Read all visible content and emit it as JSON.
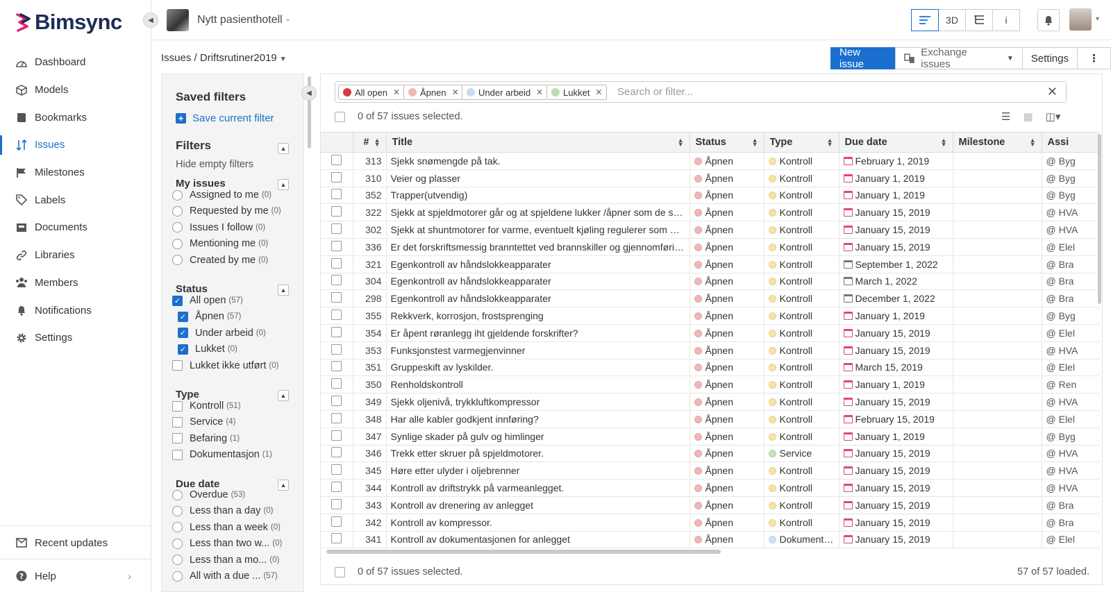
{
  "app": {
    "logo_text": "Bimsync",
    "project_name": "Nytt pasienthotell"
  },
  "nav": {
    "items": [
      {
        "label": "Dashboard",
        "icon": "dashboard-icon"
      },
      {
        "label": "Models",
        "icon": "cube-icon"
      },
      {
        "label": "Bookmarks",
        "icon": "book-icon"
      },
      {
        "label": "Issues",
        "icon": "issues-icon",
        "active": true
      },
      {
        "label": "Milestones",
        "icon": "flag-icon"
      },
      {
        "label": "Labels",
        "icon": "tag-icon"
      },
      {
        "label": "Documents",
        "icon": "inbox-icon"
      },
      {
        "label": "Libraries",
        "icon": "link-icon"
      },
      {
        "label": "Members",
        "icon": "users-icon"
      },
      {
        "label": "Notifications",
        "icon": "bell-icon"
      },
      {
        "label": "Settings",
        "icon": "gear-icon"
      }
    ],
    "recent_updates": "Recent updates",
    "help": "Help"
  },
  "topbar": {
    "view_buttons": [
      "",
      "3D",
      "",
      "i"
    ]
  },
  "breadcrumb": {
    "root": "Issues",
    "separator": "/",
    "current": "Driftsrutiner2019"
  },
  "actions": {
    "new_issue": "New issue",
    "exchange": "Exchange issues",
    "settings": "Settings"
  },
  "filters": {
    "saved_title": "Saved filters",
    "save_current": "Save current filter",
    "title": "Filters",
    "hide_empty": "Hide empty filters",
    "my_issues": {
      "title": "My issues",
      "options": [
        {
          "label": "Assigned to me",
          "count": "(0)"
        },
        {
          "label": "Requested by me",
          "count": "(0)"
        },
        {
          "label": "Issues I follow",
          "count": "(0)"
        },
        {
          "label": "Mentioning me",
          "count": "(0)"
        },
        {
          "label": "Created by me",
          "count": "(0)"
        }
      ]
    },
    "status": {
      "title": "Status",
      "options": [
        {
          "label": "All open",
          "count": "(57)",
          "checked": true,
          "indent": false
        },
        {
          "label": "Åpnen",
          "count": "(57)",
          "checked": true,
          "indent": true
        },
        {
          "label": "Under arbeid",
          "count": "(0)",
          "checked": true,
          "indent": true
        },
        {
          "label": "Lukket",
          "count": "(0)",
          "checked": true,
          "indent": true
        },
        {
          "label": "Lukket ikke utført",
          "count": "(0)",
          "checked": false,
          "indent": false
        }
      ]
    },
    "type": {
      "title": "Type",
      "options": [
        {
          "label": "Kontroll",
          "count": "(51)"
        },
        {
          "label": "Service",
          "count": "(4)"
        },
        {
          "label": "Befaring",
          "count": "(1)"
        },
        {
          "label": "Dokumentasjon",
          "count": "(1)"
        }
      ]
    },
    "due_date": {
      "title": "Due date",
      "options": [
        {
          "label": "Overdue",
          "count": "(53)"
        },
        {
          "label": "Less than a day",
          "count": "(0)"
        },
        {
          "label": "Less than a week",
          "count": "(0)"
        },
        {
          "label": "Less than two w...",
          "count": "(0)"
        },
        {
          "label": "Less than a mo...",
          "count": "(0)"
        },
        {
          "label": "All with a due ...",
          "count": "(57)"
        }
      ]
    }
  },
  "search": {
    "chips": [
      {
        "label": "All open",
        "color": "#d93b3b"
      },
      {
        "label": "Åpnen",
        "color": "#f2b6b6"
      },
      {
        "label": "Under arbeid",
        "color": "#c9daf2"
      },
      {
        "label": "Lukket",
        "color": "#b9deb0"
      }
    ],
    "placeholder": "Search or filter..."
  },
  "selection": {
    "top": "0 of 57 issues selected.",
    "bottom": "0 of 57 issues selected.",
    "loaded": "57 of 57 loaded."
  },
  "colors": {
    "accent": "#1a6fcf",
    "status_apnen": "#f2b6b6",
    "type_kontroll": "#f7e3a3",
    "type_service": "#c4e3b8",
    "type_dokument": "#cfe0f3",
    "overdue": "#e0457b"
  },
  "table": {
    "columns": [
      "#",
      "Title",
      "Status",
      "Type",
      "Due date",
      "Milestone",
      "Assi"
    ],
    "rows": [
      {
        "num": "313",
        "title": "Sjekk snømengde på tak.",
        "status": "Åpnen",
        "type": "Kontroll",
        "type_color": "#f7e3a3",
        "due": "February 1, 2019",
        "overdue": true,
        "assignee": "@ Byg"
      },
      {
        "num": "310",
        "title": "Veier og plasser",
        "status": "Åpnen",
        "type": "Kontroll",
        "type_color": "#f7e3a3",
        "due": "January 1, 2019",
        "overdue": true,
        "assignee": "@ Byg"
      },
      {
        "num": "352",
        "title": "Trapper(utvendig)",
        "status": "Åpnen",
        "type": "Kontroll",
        "type_color": "#f7e3a3",
        "due": "January 1, 2019",
        "overdue": true,
        "assignee": "@ Byg"
      },
      {
        "num": "322",
        "title": "Sjekk at spjeldmotorer går og at spjeldene lukker /åpner som de skal.",
        "status": "Åpnen",
        "type": "Kontroll",
        "type_color": "#f7e3a3",
        "due": "January 15, 2019",
        "overdue": true,
        "assignee": "@ HVA"
      },
      {
        "num": "302",
        "title": "Sjekk at shuntmotorer for varme, eventuelt kjøling regulerer som de skal",
        "status": "Åpnen",
        "type": "Kontroll",
        "type_color": "#f7e3a3",
        "due": "January 15, 2019",
        "overdue": true,
        "assignee": "@ HVA"
      },
      {
        "num": "336",
        "title": "Er det forskriftsmessig branntettet ved brannskiller og gjennomføringer?",
        "status": "Åpnen",
        "type": "Kontroll",
        "type_color": "#f7e3a3",
        "due": "January 15, 2019",
        "overdue": true,
        "assignee": "@ Elel"
      },
      {
        "num": "321",
        "title": "Egenkontroll av håndslokkeapparater",
        "status": "Åpnen",
        "type": "Kontroll",
        "type_color": "#f7e3a3",
        "due": "September 1, 2022",
        "overdue": false,
        "assignee": "@ Bra"
      },
      {
        "num": "304",
        "title": "Egenkontroll av håndslokkeapparater",
        "status": "Åpnen",
        "type": "Kontroll",
        "type_color": "#f7e3a3",
        "due": "March 1, 2022",
        "overdue": false,
        "assignee": "@ Bra"
      },
      {
        "num": "298",
        "title": "Egenkontroll av håndslokkeapparater",
        "status": "Åpnen",
        "type": "Kontroll",
        "type_color": "#f7e3a3",
        "due": "December 1, 2022",
        "overdue": false,
        "assignee": "@ Bra"
      },
      {
        "num": "355",
        "title": "Rekkverk, korrosjon, frostsprenging",
        "status": "Åpnen",
        "type": "Kontroll",
        "type_color": "#f7e3a3",
        "due": "January 1, 2019",
        "overdue": true,
        "assignee": "@ Byg"
      },
      {
        "num": "354",
        "title": "Er åpent røranlegg iht gjeldende forskrifter?",
        "status": "Åpnen",
        "type": "Kontroll",
        "type_color": "#f7e3a3",
        "due": "January 15, 2019",
        "overdue": true,
        "assignee": "@ Elel"
      },
      {
        "num": "353",
        "title": "Funksjonstest varmegjenvinner",
        "status": "Åpnen",
        "type": "Kontroll",
        "type_color": "#f7e3a3",
        "due": "January 15, 2019",
        "overdue": true,
        "assignee": "@ HVA"
      },
      {
        "num": "351",
        "title": "Gruppeskift av lyskilder.",
        "status": "Åpnen",
        "type": "Kontroll",
        "type_color": "#f7e3a3",
        "due": "March 15, 2019",
        "overdue": true,
        "assignee": "@ Elel"
      },
      {
        "num": "350",
        "title": "Renholdskontroll",
        "status": "Åpnen",
        "type": "Kontroll",
        "type_color": "#f7e3a3",
        "due": "January 1, 2019",
        "overdue": true,
        "assignee": "@ Ren"
      },
      {
        "num": "349",
        "title": "Sjekk oljenivå, trykkluftkompressor",
        "status": "Åpnen",
        "type": "Kontroll",
        "type_color": "#f7e3a3",
        "due": "January 15, 2019",
        "overdue": true,
        "assignee": "@ HVA"
      },
      {
        "num": "348",
        "title": "Har alle kabler godkjent innføring?",
        "status": "Åpnen",
        "type": "Kontroll",
        "type_color": "#f7e3a3",
        "due": "February 15, 2019",
        "overdue": true,
        "assignee": "@ Elel"
      },
      {
        "num": "347",
        "title": "Synlige skader på gulv og himlinger",
        "status": "Åpnen",
        "type": "Kontroll",
        "type_color": "#f7e3a3",
        "due": "January 1, 2019",
        "overdue": true,
        "assignee": "@ Byg"
      },
      {
        "num": "346",
        "title": "Trekk etter skruer på spjeldmotorer.",
        "status": "Åpnen",
        "type": "Service",
        "type_color": "#c4e3b8",
        "due": "January 15, 2019",
        "overdue": true,
        "assignee": "@ HVA"
      },
      {
        "num": "345",
        "title": "Høre etter ulyder i oljebrenner",
        "status": "Åpnen",
        "type": "Kontroll",
        "type_color": "#f7e3a3",
        "due": "January 15, 2019",
        "overdue": true,
        "assignee": "@ HVA"
      },
      {
        "num": "344",
        "title": "Kontroll av driftstrykk på varmeanlegget.",
        "status": "Åpnen",
        "type": "Kontroll",
        "type_color": "#f7e3a3",
        "due": "January 15, 2019",
        "overdue": true,
        "assignee": "@ HVA"
      },
      {
        "num": "343",
        "title": "Kontroll av drenering av anlegget",
        "status": "Åpnen",
        "type": "Kontroll",
        "type_color": "#f7e3a3",
        "due": "January 15, 2019",
        "overdue": true,
        "assignee": "@ Bra"
      },
      {
        "num": "342",
        "title": "Kontroll av kompressor.",
        "status": "Åpnen",
        "type": "Kontroll",
        "type_color": "#f7e3a3",
        "due": "January 15, 2019",
        "overdue": true,
        "assignee": "@ Bra"
      },
      {
        "num": "341",
        "title": "Kontroll av dokumentasjonen for anlegget",
        "status": "Åpnen",
        "type": "Dokument…",
        "type_color": "#cfe0f3",
        "due": "January 15, 2019",
        "overdue": true,
        "assignee": "@ Elel"
      }
    ]
  }
}
